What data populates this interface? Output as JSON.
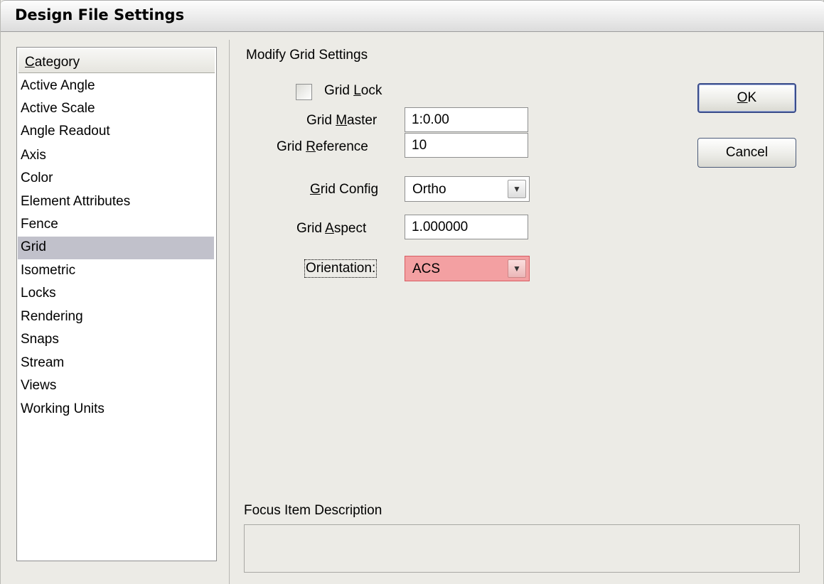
{
  "window": {
    "title": "Design File Settings"
  },
  "category": {
    "header": "Category",
    "items": [
      "Active Angle",
      "Active Scale",
      "Angle Readout",
      "Axis",
      "Color",
      "Element Attributes",
      "Fence",
      "Grid",
      "Isometric",
      "Locks",
      "Rendering",
      "Snaps",
      "Stream",
      "Views",
      "Working Units"
    ],
    "selected": "Grid"
  },
  "grid_settings": {
    "section_title": "Modify Grid Settings",
    "grid_lock": {
      "label": "Grid Lock",
      "checked": false
    },
    "grid_master": {
      "label": "Grid Master",
      "value": "1:0.00"
    },
    "grid_reference": {
      "label": "Grid Reference",
      "value": "10"
    },
    "grid_config": {
      "label": "Grid Config",
      "value": "Ortho"
    },
    "grid_aspect": {
      "label": "Grid Aspect",
      "value": "1.000000"
    },
    "orientation": {
      "label": "Orientation:",
      "value": "ACS"
    }
  },
  "buttons": {
    "ok": "OK",
    "cancel": "Cancel"
  },
  "focus_description": {
    "label": "Focus Item Description",
    "text": ""
  },
  "colors": {
    "selection": "#c1c1cb",
    "highlight": "#f3a0a2",
    "dialog_bg": "#ecebe6"
  }
}
